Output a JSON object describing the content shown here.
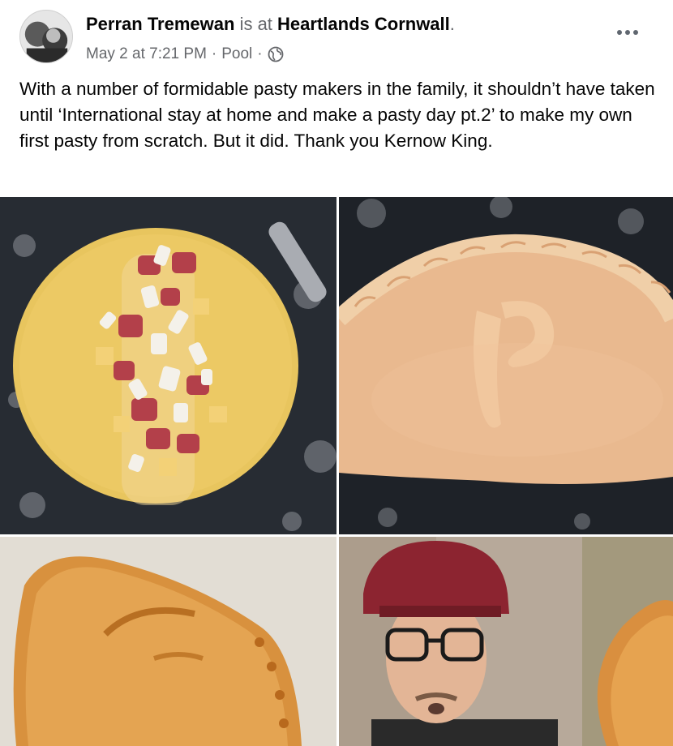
{
  "post": {
    "author": "Perran Tremewan",
    "connector": "is at",
    "place": "Heartlands Cornwall",
    "period": ".",
    "date": "May 2 at 7:21 PM",
    "separator": "·",
    "location": "Pool",
    "privacy_icon": "globe-icon",
    "body": "With a number of formidable pasty makers in the family, it shouldn’t have taken until ‘International stay at home and make a pasty day pt.2’ to make my own first pasty from scratch. But it did. Thank you Kernow King."
  },
  "photos": [
    {
      "name": "photo-raw-pasty-filling"
    },
    {
      "name": "photo-crimped-pasty"
    },
    {
      "name": "photo-baked-pasty"
    },
    {
      "name": "photo-man-in-cap"
    }
  ],
  "colors": {
    "text": "#050505",
    "muted": "#65676b",
    "background": "#ffffff"
  }
}
